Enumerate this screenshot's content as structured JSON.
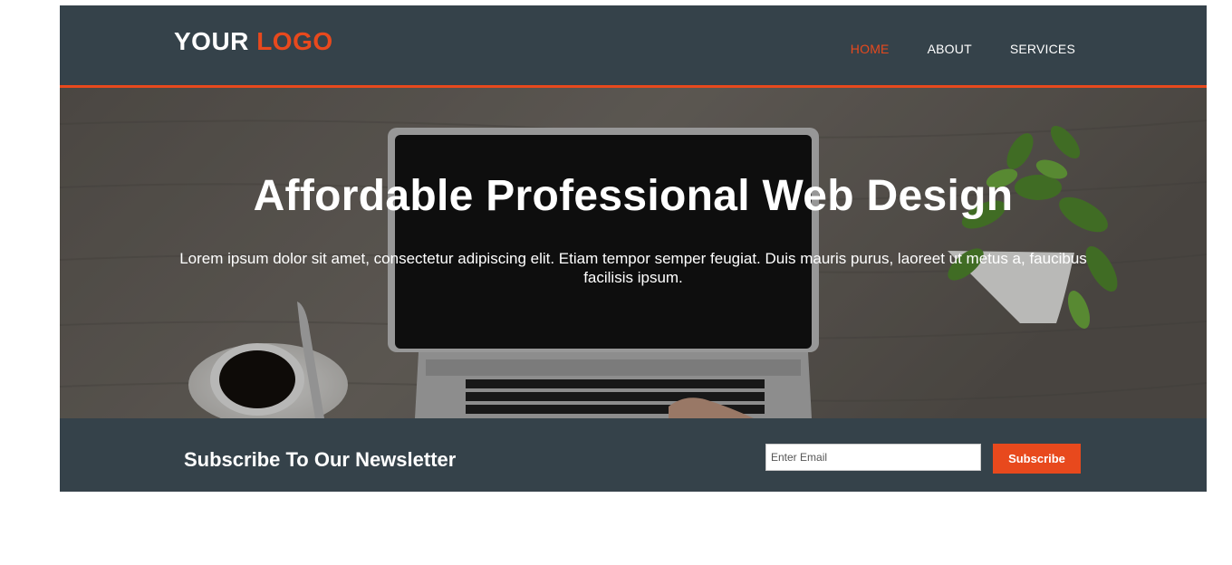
{
  "header": {
    "logo_part1": "YOUR",
    "logo_part2": "LOGO",
    "nav": [
      {
        "label": "HOME",
        "active": true
      },
      {
        "label": "ABOUT",
        "active": false
      },
      {
        "label": "SERVICES",
        "active": false
      }
    ]
  },
  "hero": {
    "title": "Affordable Professional Web Design",
    "text": "Lorem ipsum dolor sit amet, consectetur adipiscing elit. Etiam tempor semper feugiat. Duis mauris purus, laoreet ut metus a, faucibus facilisis ipsum."
  },
  "newsletter": {
    "title": "Subscribe To Our Newsletter",
    "email_placeholder": "Enter Email",
    "button_label": "Subscribe"
  },
  "colors": {
    "dark": "#35424a",
    "accent": "#e8491d"
  }
}
